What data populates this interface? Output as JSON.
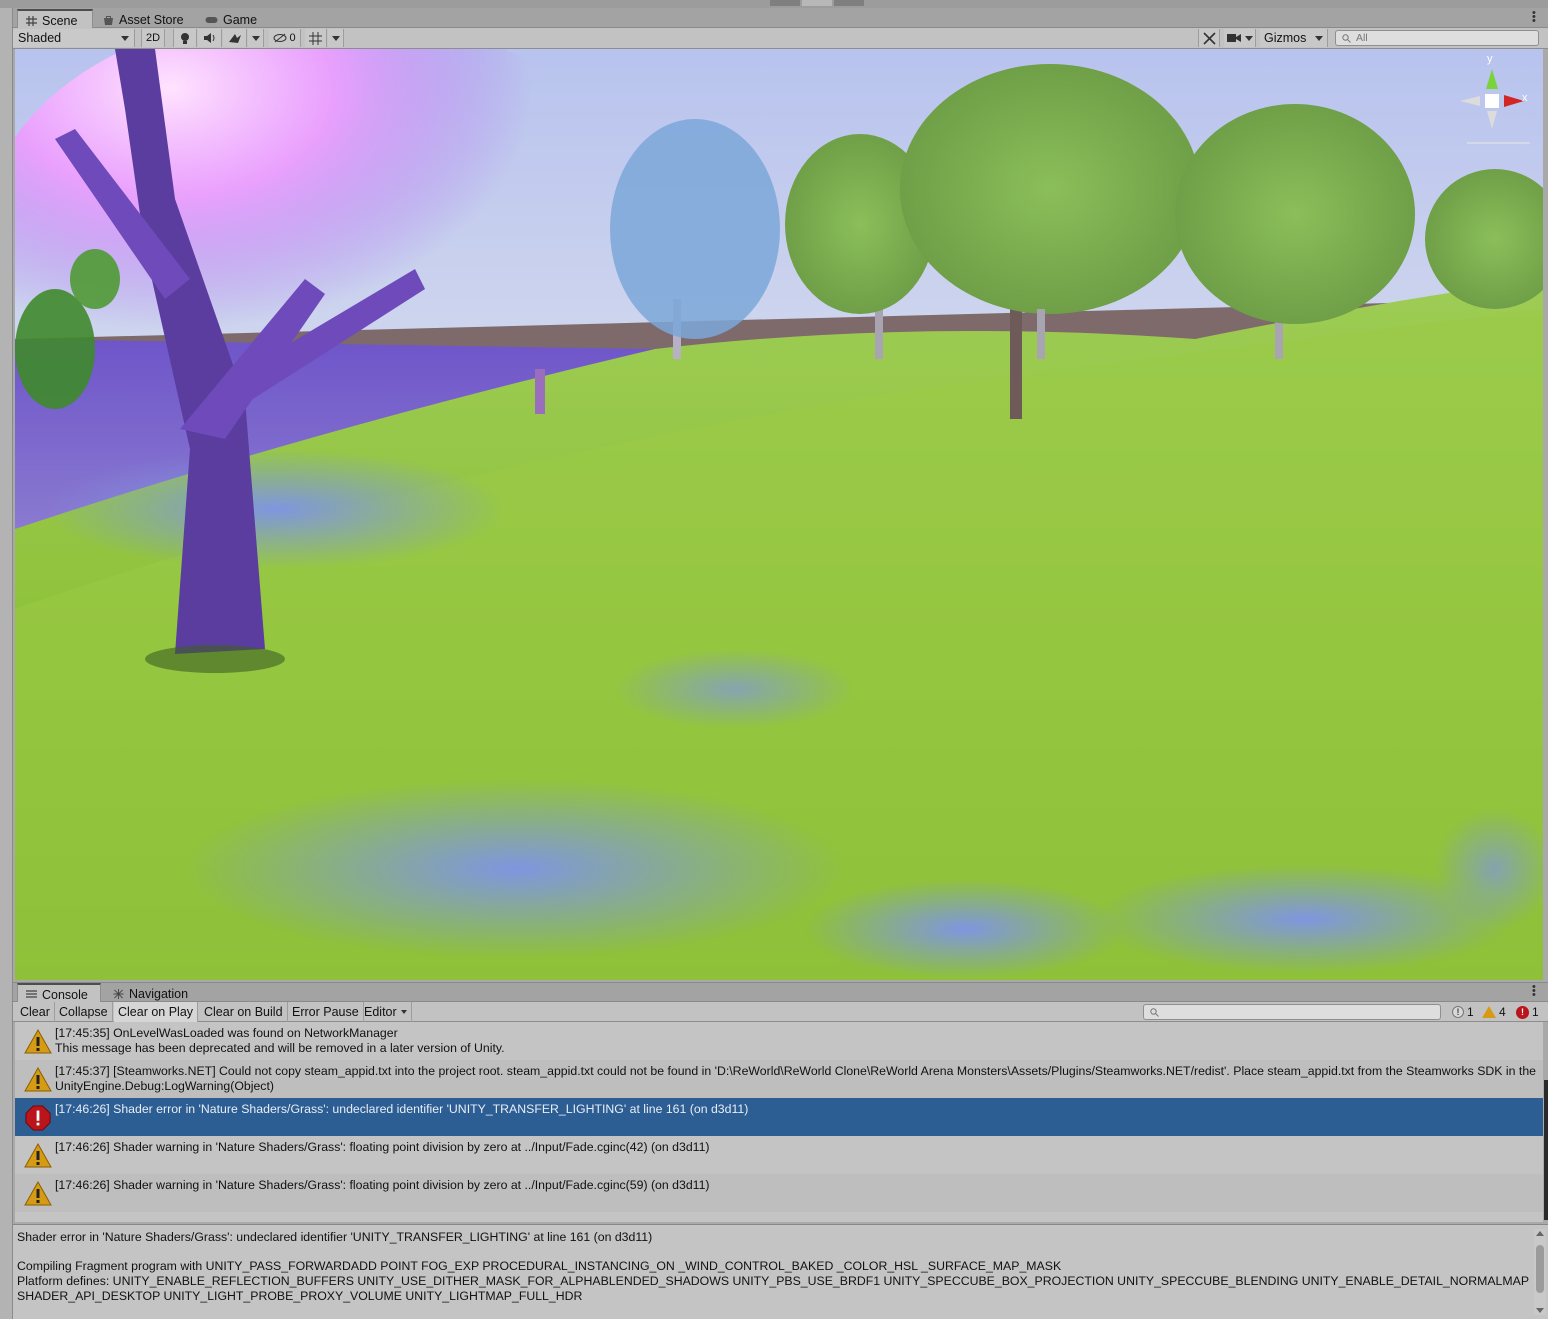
{
  "scene_tabs": [
    {
      "label": "Scene",
      "icon": "grid-icon",
      "active": true
    },
    {
      "label": "Asset Store",
      "icon": "bag-icon",
      "active": false
    },
    {
      "label": "Game",
      "icon": "gamepad-icon",
      "active": false
    }
  ],
  "scene_toolbar": {
    "draw_mode": "Shaded",
    "mode_2d": "2D",
    "hidden_count": "0",
    "gizmos_label": "Gizmos",
    "search_placeholder": "All"
  },
  "console_tabs": [
    {
      "label": "Console",
      "icon": "console-icon",
      "active": true
    },
    {
      "label": "Navigation",
      "icon": "navigation-icon",
      "active": false
    }
  ],
  "console_toolbar": {
    "clear": "Clear",
    "collapse": "Collapse",
    "clear_on_play": "Clear on Play",
    "clear_on_build": "Clear on Build",
    "error_pause": "Error Pause",
    "editor": "Editor",
    "info_count": "1",
    "warning_count": "4",
    "error_count": "1"
  },
  "logs": [
    {
      "type": "warning",
      "line1": "[17:45:35] OnLevelWasLoaded was found on NetworkManager",
      "line2": "This message has been deprecated and will be removed in a later version of Unity."
    },
    {
      "type": "warning",
      "line1": "[17:45:37] [Steamworks.NET] Could not copy steam_appid.txt into the project root. steam_appid.txt could not be found in 'D:\\ReWorld\\ReWorld Clone\\ReWorld Arena Monsters\\Assets/Plugins/Steamworks.NET/redist'. Place steam_appid.txt from the Steamworks SDK in the",
      "line2": "UnityEngine.Debug:LogWarning(Object)"
    },
    {
      "type": "error",
      "line1": "[17:46:26] Shader error in 'Nature Shaders/Grass': undeclared identifier 'UNITY_TRANSFER_LIGHTING' at line 161 (on d3d11)",
      "line2": ""
    },
    {
      "type": "warning",
      "line1": "[17:46:26] Shader warning in 'Nature Shaders/Grass': floating point division by zero at ../Input/Fade.cginc(42) (on d3d11)",
      "line2": ""
    },
    {
      "type": "warning",
      "line1": "[17:46:26] Shader warning in 'Nature Shaders/Grass': floating point division by zero at ../Input/Fade.cginc(59) (on d3d11)",
      "line2": ""
    }
  ],
  "detail": {
    "line1": "Shader error in 'Nature Shaders/Grass': undeclared identifier 'UNITY_TRANSFER_LIGHTING' at line 161 (on d3d11)",
    "line2": "Compiling Fragment program with UNITY_PASS_FORWARDADD POINT FOG_EXP PROCEDURAL_INSTANCING_ON _WIND_CONTROL_BAKED _COLOR_HSL _SURFACE_MAP_MASK",
    "line3": "Platform defines: UNITY_ENABLE_REFLECTION_BUFFERS UNITY_USE_DITHER_MASK_FOR_ALPHABLENDED_SHADOWS UNITY_PBS_USE_BRDF1 UNITY_SPECCUBE_BOX_PROJECTION UNITY_SPECCUBE_BLENDING UNITY_ENABLE_DETAIL_NORMALMAP",
    "line4": "SHADER_API_DESKTOP UNITY_LIGHT_PROBE_PROXY_VOLUME UNITY_LIGHTMAP_FULL_HDR"
  },
  "gizmo_axes": {
    "y": "y",
    "x": "x"
  },
  "colors": {
    "selection": "#2c5d93",
    "warning": "#d69b14",
    "error": "#b9151b",
    "grass": "#8fc13f",
    "glow": "#e7a2f7"
  }
}
